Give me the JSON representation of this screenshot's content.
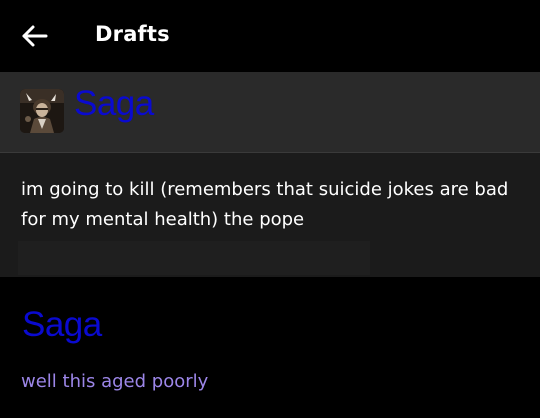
{
  "header": {
    "back_icon": "arrow-left-icon",
    "title": "Drafts"
  },
  "post": {
    "avatar_icon": "avatar-image",
    "username": "Saga",
    "body": "im going to kill (remembers that suicide jokes are bad for my mental health) the pope"
  },
  "reply": {
    "username": "Saga",
    "text": "well this aged poorly"
  },
  "colors": {
    "background": "#000000",
    "card_background": "#1b1b1b",
    "card_header_background": "#2a2a2a",
    "username_blue": "#0a0ad0",
    "reply_text_purple": "#9c86e8",
    "text_white": "#ffffff"
  }
}
